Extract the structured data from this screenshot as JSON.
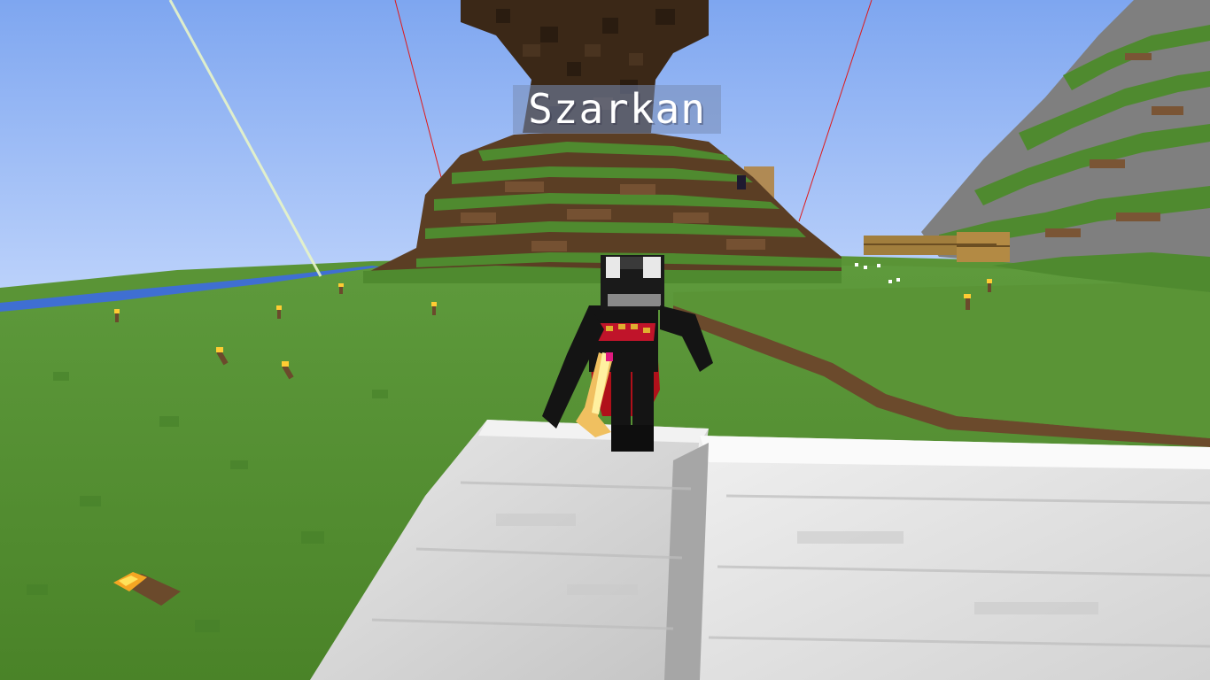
{
  "nametag": {
    "player_name": "Szarkan"
  },
  "colors": {
    "sky_top": "#7ea6f0",
    "sky_bottom": "#bcd2fb",
    "grass": "#4f8a2f",
    "dirt": "#6b4a2c",
    "bark": "#3b2817",
    "stone": "#8a8a8a",
    "quartz": "#dcdcdc",
    "water": "#3f6fd2",
    "beacon_beam": "#e8f5c8",
    "red_line": "#e01818",
    "nametag_bg": "#788cb4"
  },
  "scene": {
    "view": "third-person-back",
    "player_skin": "black-white-knight-with-red-cape",
    "held_item": "golden-sword",
    "structures": [
      "giant-dark-oak-tree",
      "grass-hill",
      "stone-mountain",
      "quartz-blocks",
      "wooden-planks-structure",
      "river"
    ]
  }
}
